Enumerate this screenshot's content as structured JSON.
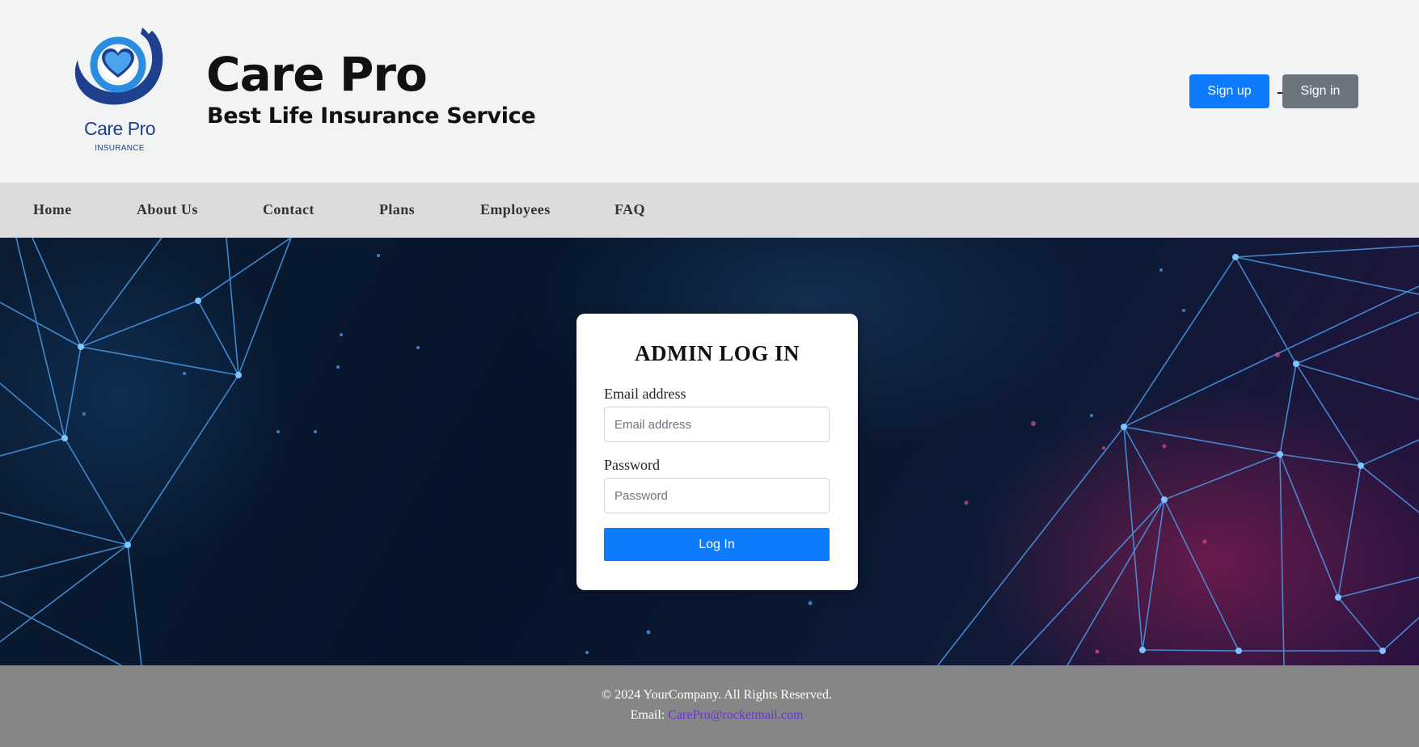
{
  "header": {
    "logo_name": "Care Pro",
    "logo_sub": "INSURANCE",
    "title": "Care Pro",
    "tagline": "Best Life Insurance Service",
    "signup_label": "Sign up",
    "signin_label": "Sign in"
  },
  "nav": {
    "items": [
      {
        "label": "Home"
      },
      {
        "label": "About Us"
      },
      {
        "label": "Contact"
      },
      {
        "label": "Plans"
      },
      {
        "label": "Employees"
      },
      {
        "label": "FAQ"
      }
    ]
  },
  "login": {
    "title": "ADMIN LOG IN",
    "email_label": "Email address",
    "email_placeholder": "Email address",
    "email_value": "",
    "password_label": "Password",
    "password_placeholder": "Password",
    "password_value": "",
    "submit_label": "Log In"
  },
  "footer": {
    "copyright": "© 2024 YourCompany. All Rights Reserved.",
    "email_prefix": "Email: ",
    "email": "CarePro@rocketmail.com"
  },
  "colors": {
    "primary": "#0d7bfc",
    "secondary": "#6c757d",
    "nav_bg": "#dcdcdc",
    "footer_bg": "#868686",
    "logo_blue": "#1f3f8f",
    "link": "#6a2fe0"
  },
  "icons": {
    "logo": "heart-hands-icon"
  }
}
